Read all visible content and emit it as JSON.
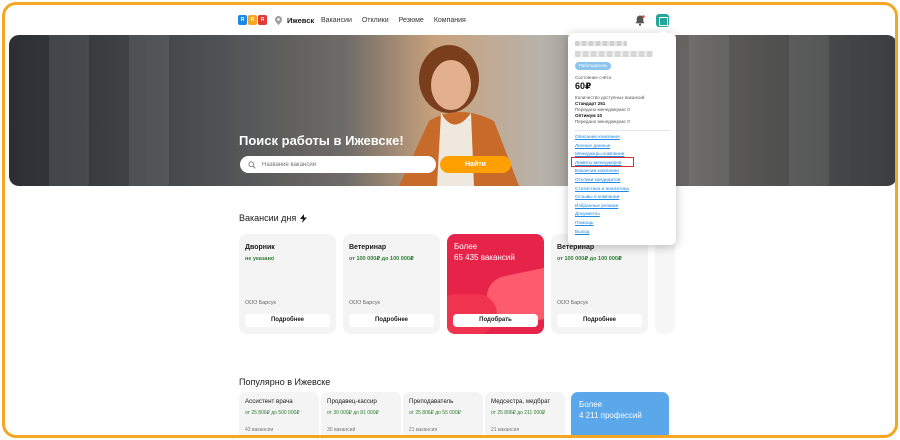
{
  "header": {
    "city": "Ижевск",
    "nav": [
      "Вакансии",
      "Отклики",
      "Резюме",
      "Компания"
    ]
  },
  "hero": {
    "title": "Поиск работы в Ижевске!",
    "search_placeholder": "Название вакансии",
    "search_button": "Найти"
  },
  "vacancies": {
    "title": "Вакансии дня",
    "cards": [
      {
        "title": "Дворник",
        "salary": "не указано",
        "company": "ООО Барсук",
        "button": "Подробнее"
      },
      {
        "title": "Ветеринар",
        "salary": "от 100 000₽ до 100 000₽",
        "company": "ООО Барсук",
        "button": "Подробнее"
      },
      {
        "title": "Ветеринар",
        "salary": "от 100 000₽ до 100 000₽",
        "company": "ООО Барсук",
        "button": "Подробнее"
      }
    ],
    "promo": {
      "line1": "Более",
      "line2": "65 435 вакансий",
      "button": "Подобрать"
    }
  },
  "popular": {
    "title": "Популярно в Ижевске",
    "cards": [
      {
        "title": "Ассистент врача",
        "salary": "от 25 806₽ до 500 000₽",
        "count": "43 вакансии"
      },
      {
        "title": "Продавец-кассир",
        "salary": "от 30 000₽ до 81 000₽",
        "count": "30 вакансий"
      },
      {
        "title": "Преподаватель",
        "salary": "от 25 806₽ до 55 000₽",
        "count": "21 вакансия"
      },
      {
        "title": "Медсестра, медбрат",
        "salary": "от 25 806₽ до 211 000₽",
        "count": "21 вакансия"
      }
    ],
    "promo": {
      "line1": "Более",
      "line2": "4 211 профессий"
    }
  },
  "account_menu": {
    "role_badge": "Работодатель",
    "balance_label": "Состояние счёта",
    "balance": "60₽",
    "vacancies_label": "Количество доступных вакансий",
    "standard": "Стандарт 251",
    "transfer1": "Передано менеджерам: 0",
    "optimum": "Оптимум 10",
    "transfer2": "Передано менеджерам: 0",
    "links": [
      "Описание компании",
      "Личные данные",
      "Менеджеры компании",
      "Лимиты менеджеров",
      "Вакансии компании",
      "Отклики кандидатов",
      "Статистика и аналитика",
      "Отзывы о компании",
      "Избранные резюме",
      "Документы",
      "Помощь",
      "Выход"
    ]
  },
  "colors": {
    "accent_frame": "#f5a623",
    "search_button": "#ffa000",
    "promo_red": "#e6244a",
    "promo_blue": "#5aa7ea",
    "salary_green": "#2e7d32",
    "link_blue": "#1e88e5",
    "highlight_red": "#d32f2f"
  }
}
